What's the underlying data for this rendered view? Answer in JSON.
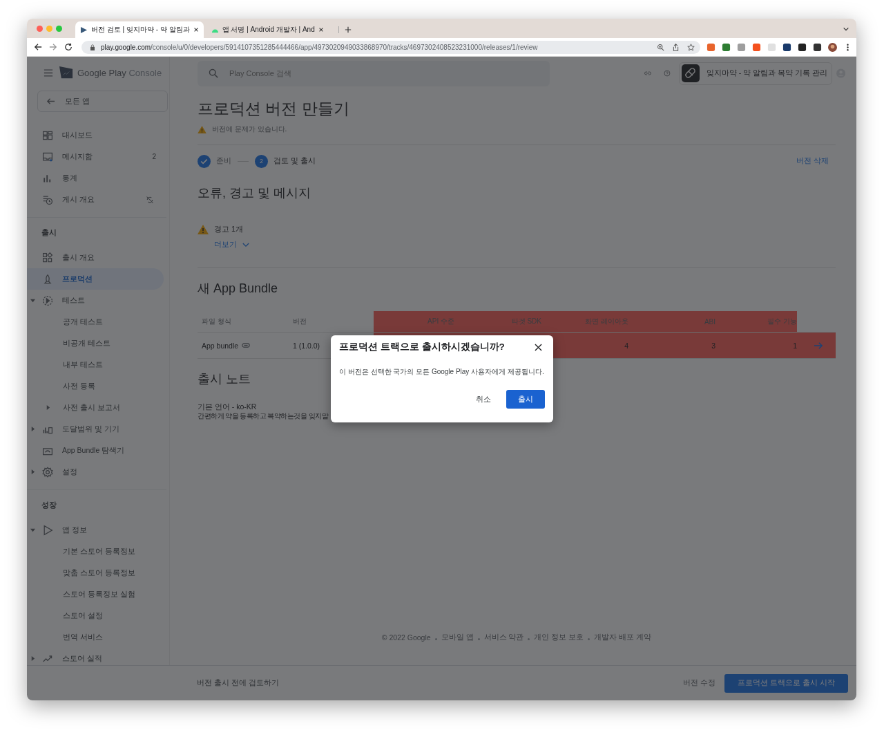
{
  "browser": {
    "tabs": [
      {
        "title": "버전 검토 | 잊지마약 - 약 알림과",
        "selected": true
      },
      {
        "title": "앱 서명  |  Android 개발자  |  And",
        "selected": false
      }
    ],
    "url_host": "play.google.com",
    "url_path": "/console/u/0/developers/5914107351285444466/app/4973020949033868970/tracks/4697302408523231000/releases/1/review"
  },
  "header": {
    "brand": "Google Play",
    "product": "Console",
    "search_placeholder": "Play Console 검색",
    "app_name": "잊지마약 - 약 알림과 복약 기록 관리"
  },
  "sidebar": {
    "back": "모든 앱",
    "sections": [
      {
        "items": [
          {
            "label": "대시보드",
            "selected": false
          },
          {
            "label": "메시지함",
            "badge": "2",
            "selected": false
          },
          {
            "label": "통계",
            "selected": false
          },
          {
            "label": "게시 개요",
            "selected": false
          }
        ]
      },
      {
        "title": "출시",
        "items": [
          {
            "label": "출시 개요",
            "selected": false
          },
          {
            "label": "프로덕션",
            "selected": true
          },
          {
            "label": "테스트",
            "selected": false,
            "expanded": true,
            "children": [
              {
                "label": "공개 테스트",
                "selected": false
              },
              {
                "label": "비공개 테스트",
                "selected": false
              },
              {
                "label": "내부 테스트",
                "selected": false
              },
              {
                "label": "사전 등록",
                "selected": false
              },
              {
                "label": "사전 출시 보고서",
                "selected": false,
                "expanded": false
              }
            ]
          },
          {
            "label": "도달범위 및 기기",
            "selected": false,
            "expanded": false
          },
          {
            "label": "App Bundle 탐색기",
            "selected": false
          },
          {
            "label": "설정",
            "selected": false,
            "expanded": false
          }
        ]
      },
      {
        "title": "성장",
        "items": [
          {
            "label": "앱 정보",
            "selected": false,
            "expanded": true,
            "children": [
              {
                "label": "기본 스토어 등록정보",
                "selected": false
              },
              {
                "label": "맞춤 스토어 등록정보",
                "selected": false
              },
              {
                "label": "스토어 등록정보 실험",
                "selected": false
              },
              {
                "label": "스토어 설정",
                "selected": false
              },
              {
                "label": "번역 서비스",
                "selected": false
              }
            ]
          },
          {
            "label": "스토어 실적",
            "selected": false,
            "expanded": false
          }
        ]
      }
    ]
  },
  "page": {
    "title": "프로덕션 버전 만들기",
    "issue": "버전에 문제가 있습니다.",
    "steps": [
      {
        "label": "준비",
        "done": true,
        "selected": false
      },
      {
        "label": "검토 및 출시",
        "number": "2",
        "done": false,
        "selected": true
      }
    ],
    "delete_link": "버전 삭제",
    "messages_heading": "오류, 경고 및 메시지",
    "warning": "경고 1개",
    "more": "더보기",
    "bundle_heading": "새 App Bundle",
    "table": {
      "columns": [
        "파일 형식",
        "버전",
        "API 수준",
        "타겟 SDK",
        "화면 레이아웃",
        "ABI",
        "필수 기능"
      ],
      "rows": [
        {
          "cells": [
            "App bundle",
            "1 (1.0.0)",
            null,
            null,
            "4",
            "3",
            "1"
          ]
        }
      ]
    },
    "notes_heading": "출시 노트",
    "notes_language": "기본 언어 - ko-KR",
    "notes_text": "간편하게 약을 등록하고 복약하는것을 잊지말"
  },
  "footer": {
    "copyright": "© 2022 Google",
    "links": [
      "모바일 앱",
      "서비스 약관",
      "개인 정보 보호",
      "개발자 배포 계약"
    ]
  },
  "bottom_bar": {
    "hint": "버전 출시 전에 검토하기",
    "edit": "버전 수정",
    "start": "프로덕션 트랙으로 출시 시작"
  },
  "dialog": {
    "title": "프로덕션 트랙으로 출시하시겠습니까?",
    "body": "이 버전은 선택한 국가의 모든 Google Play 사용자에게 제공됩니다.",
    "cancel": "취소",
    "confirm": "출시"
  }
}
